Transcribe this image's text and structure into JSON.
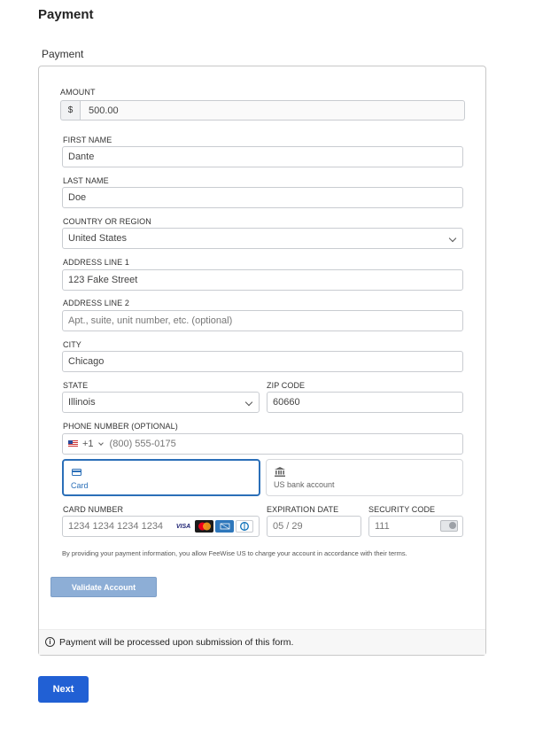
{
  "page": {
    "title": "Payment"
  },
  "section": {
    "title": "Payment"
  },
  "amount": {
    "label": "AMOUNT",
    "currency_symbol": "$",
    "value": "500.00"
  },
  "first_name": {
    "label": "FIRST NAME",
    "value": "Dante"
  },
  "last_name": {
    "label": "LAST NAME",
    "value": "Doe"
  },
  "country": {
    "label": "COUNTRY OR REGION",
    "value": "United States"
  },
  "address1": {
    "label": "ADDRESS LINE 1",
    "value": "123 Fake Street"
  },
  "address2": {
    "label": "ADDRESS LINE 2",
    "placeholder": "Apt., suite, unit number, etc. (optional)"
  },
  "city": {
    "label": "CITY",
    "value": "Chicago"
  },
  "state": {
    "label": "STATE",
    "value": "Illinois"
  },
  "zip": {
    "label": "ZIP CODE",
    "value": "60660"
  },
  "phone": {
    "label": "PHONE NUMBER (OPTIONAL)",
    "country_code": "+1",
    "placeholder": "(800) 555-0175"
  },
  "payment_tabs": [
    {
      "label": "Card",
      "icon": "credit-card-icon",
      "selected": true
    },
    {
      "label": "US bank account",
      "icon": "bank-icon",
      "selected": false
    }
  ],
  "card_number": {
    "label": "CARD NUMBER",
    "placeholder": "1234 1234 1234 1234",
    "brands": [
      "VISA",
      "Mastercard",
      "American Express",
      "Diners Club"
    ],
    "visa_text": "VISA"
  },
  "expiration": {
    "label": "EXPIRATION DATE",
    "placeholder": "05 / 29"
  },
  "security_code": {
    "label": "SECURITY CODE",
    "placeholder": "111"
  },
  "consent_text": "By providing your payment information, you allow FeeWise US to charge your account in accordance with their terms.",
  "validate_button": "Validate Account",
  "info_message": "Payment will be processed upon submission of this form.",
  "next_button": "Next",
  "colors": {
    "primary": "#2160d4",
    "selected_tab": "#2b6fb8",
    "validate_button": "#8daed6"
  }
}
